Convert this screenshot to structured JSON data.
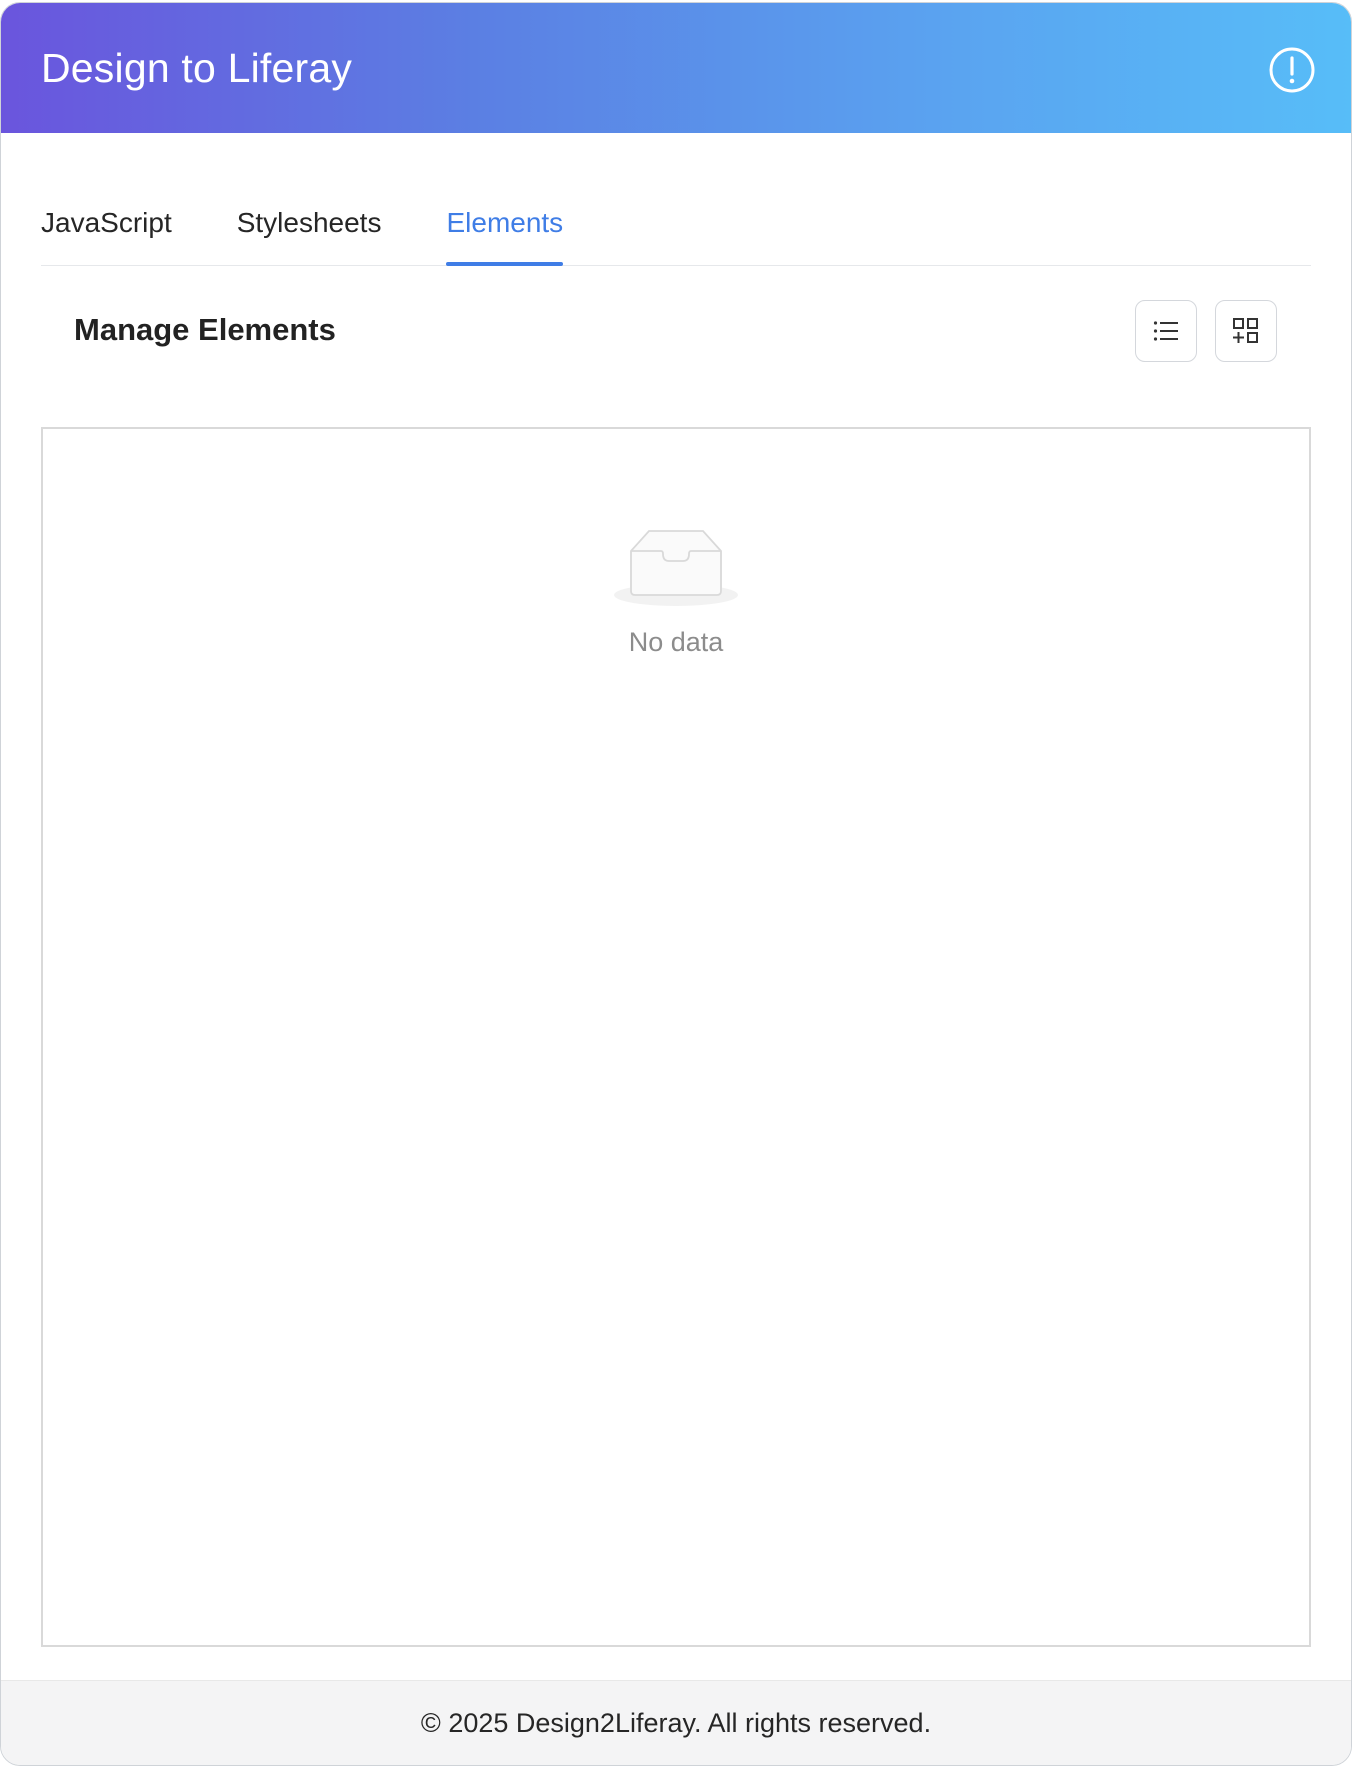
{
  "colors": {
    "gradient_start": "#6a55dd",
    "gradient_end": "#57bdf8",
    "accent": "#3f7de6"
  },
  "header": {
    "title": "Design to Liferay",
    "info_icon": "info-exclamation-icon"
  },
  "tabs": [
    {
      "label": "JavaScript",
      "active": false
    },
    {
      "label": "Stylesheets",
      "active": false
    },
    {
      "label": "Elements",
      "active": true
    }
  ],
  "section": {
    "title": "Manage Elements",
    "list_view_icon": "list-view-icon",
    "grid_view_icon": "grid-add-icon"
  },
  "empty_state": {
    "icon": "empty-inbox-icon",
    "text": "No data"
  },
  "footer": {
    "text": "© 2025 Design2Liferay. All rights reserved."
  }
}
